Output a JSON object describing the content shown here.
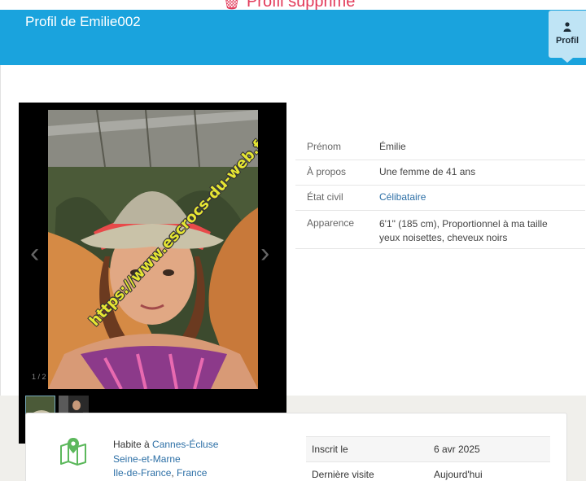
{
  "notice": {
    "text": "Profil supprimé"
  },
  "header": {
    "title": "Profil de Emilie002",
    "profil_tab_label": "Profil",
    "profil_icon": "user-icon",
    "accent_color": "#1aa3dd"
  },
  "gallery": {
    "counter": "1 / 2",
    "watermark": "https://www.escrocs-du-web.fr",
    "prev_icon": "chevron-left-icon",
    "next_icon": "chevron-right-icon"
  },
  "details": [
    {
      "label": "Prénom",
      "value": "Émilie"
    },
    {
      "label": "À propos",
      "value": "Une femme de 41 ans"
    },
    {
      "label": "État civil",
      "value": "Célibataire"
    },
    {
      "label": "Apparence",
      "value_prefix": "6'1\" (185 cm), ",
      "value_link1": "Proportionnel à ma taille",
      "value_link2": "yeux noisettes",
      "value_sep": ", ",
      "value_link3": "cheveux noirs"
    }
  ],
  "location": {
    "prefix": "Habite à ",
    "city": "Cannes-Écluse",
    "department": "Seine-et-Marne",
    "region": "Ile-de-France",
    "separator": ", ",
    "country": "France",
    "icon": "map-pin-icon"
  },
  "stats": [
    {
      "label": "Inscrit le",
      "value": "6 avr 2025"
    },
    {
      "label": "Dernière visite",
      "value": "Aujourd'hui"
    }
  ]
}
